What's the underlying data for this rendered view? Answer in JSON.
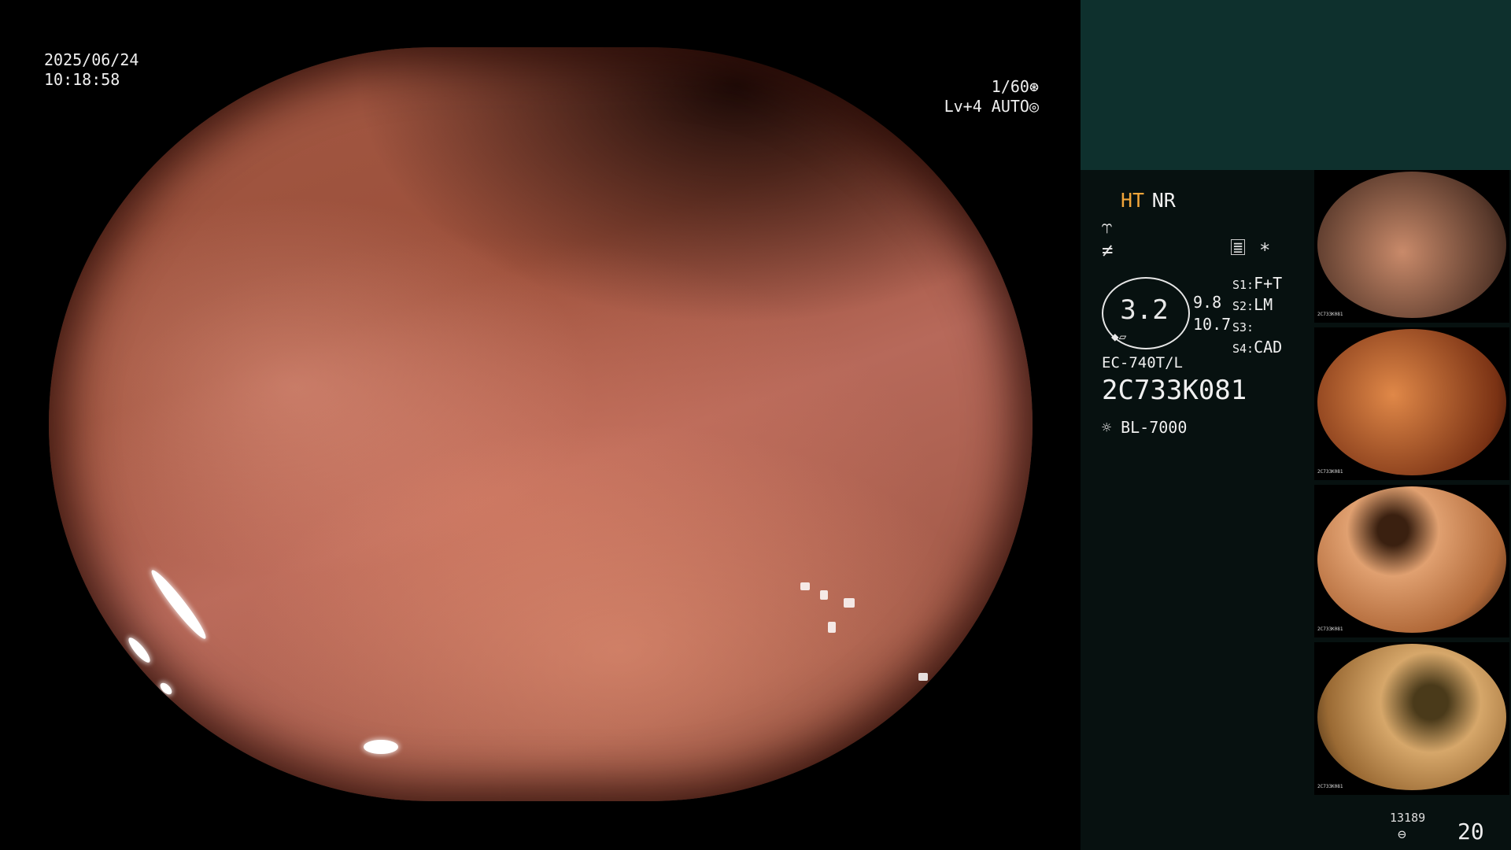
{
  "overlay": {
    "date": "2025/06/24",
    "time": "10:18:58",
    "shutter": "1/60",
    "level": "Lv+4 AUTO"
  },
  "panel": {
    "mode_ht": "HT",
    "mode_nr": "NR",
    "zoom": "3.2",
    "value_a": "9.8",
    "value_b": "10.7",
    "s1_key": "S1:",
    "s1_val": "F+T",
    "s2_key": "S2:",
    "s2_val": "LM",
    "s3_key": "S3:",
    "s4_key": "S4:",
    "s4_val": "CAD",
    "scope_model": "EC-740T/L",
    "scope_serial": "2C733K081",
    "light_source": "BL-7000",
    "storage_count": "13189",
    "image_count": "20",
    "star": "*"
  },
  "thumbnails": [
    {
      "name": "thumb-1",
      "colors": [
        "#c98a6a",
        "#5a3a2c"
      ]
    },
    {
      "name": "thumb-2",
      "colors": [
        "#d8783f",
        "#7a3214"
      ]
    },
    {
      "name": "thumb-3",
      "colors": [
        "#e0a070",
        "#5a3018"
      ]
    },
    {
      "name": "thumb-4",
      "colors": [
        "#d6a76a",
        "#4a3a1a"
      ]
    }
  ],
  "thumbnail_label": "2C733K081"
}
